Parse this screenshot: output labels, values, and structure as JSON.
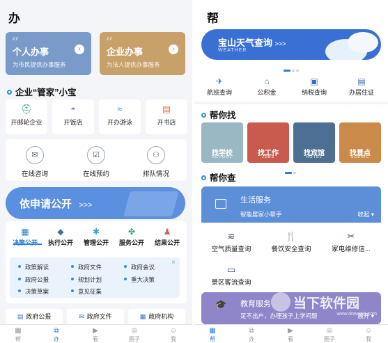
{
  "left": {
    "title": "办",
    "cards": [
      {
        "title": "个人办事",
        "sub": "为市民提供办事服务",
        "color": "#7a9bc9"
      },
      {
        "title": "企业办事",
        "sub": "为法人提供办事服务",
        "color": "#c7a06a"
      }
    ],
    "section1": "企业“管家”小宝",
    "quick": [
      "开邮轮企业",
      "开饭店",
      "开办游泳",
      "开书店"
    ],
    "quick_icons": [
      "⛑",
      "◓",
      "≈",
      "▤"
    ],
    "services": [
      "在线咨询",
      "在线预约",
      "排队情况"
    ],
    "service_icons": [
      "✉",
      "☑",
      "⚇"
    ],
    "banner": "依申请公开",
    "banner_arrows": ">>>",
    "tabs": [
      "决策公开",
      "执行公开",
      "管理公开",
      "服务公开",
      "结果公开"
    ],
    "tab_icons": [
      "▦",
      "◆",
      "✱",
      "✤",
      "♟"
    ],
    "info_items": [
      "政策解读",
      "政府文件",
      "政府会议",
      "政府公报",
      "规划计划",
      "重大决策",
      "决策草案",
      "意见征集"
    ],
    "close": "×",
    "bottom": [
      "政府公报",
      "政府文件",
      "政府机构"
    ],
    "bottom_icons": [
      "▤",
      "✉",
      "▦"
    ]
  },
  "right": {
    "title": "帮",
    "weather_title": "宝山天气查询",
    "weather_arrows": ">>>",
    "weather_sub": "WEATHER",
    "services": [
      "航班查询",
      "公积金",
      "纳税查询",
      "办居住证"
    ],
    "service_icons": [
      "✈",
      "⌂",
      "▣",
      "▤"
    ],
    "section_find": "帮你找",
    "photos": [
      {
        "t": "找学校",
        "s": "SCHOOL",
        "color": "#9ab7c4"
      },
      {
        "t": "找工作",
        "s": "JOBS",
        "color": "#c85a4e"
      },
      {
        "t": "找宾馆",
        "s": "HOTEL",
        "color": "#4e6f94"
      },
      {
        "t": "找景点",
        "s": "SCENIC",
        "color": "#c98a4a"
      }
    ],
    "section_check": "帮你查",
    "life_title": "生活服务",
    "life_sub": "智能居家小帮手",
    "collapse": "收起",
    "queries": [
      "空气质量查询",
      "餐饮安全查询",
      "家电维修信...",
      "景区客流查询"
    ],
    "query_icons": [
      "≋",
      "🍴",
      "✂",
      "▭"
    ],
    "edu_title": "教育服务",
    "edu_sub": "足不出户，办理孩子上学问题",
    "edu_expand": "展开"
  },
  "nav_left": [
    {
      "label": "帮",
      "icon": "▦",
      "active": false
    },
    {
      "label": "办",
      "icon": "⧉",
      "active": true
    },
    {
      "label": "看",
      "icon": "▶",
      "active": false
    },
    {
      "label": "圈子",
      "icon": "◎",
      "active": false
    },
    {
      "label": "我",
      "icon": "☺",
      "active": false
    }
  ],
  "nav_right": [
    {
      "label": "帮",
      "icon": "▦",
      "active": true
    },
    {
      "label": "办",
      "icon": "⧉",
      "active": false
    },
    {
      "label": "看",
      "icon": "▶",
      "active": false
    },
    {
      "label": "圈子",
      "icon": "◎",
      "active": false
    },
    {
      "label": "我",
      "icon": "☺",
      "active": false
    }
  ],
  "watermark": "当下软件园",
  "watermark_url": "www.downxia.com"
}
